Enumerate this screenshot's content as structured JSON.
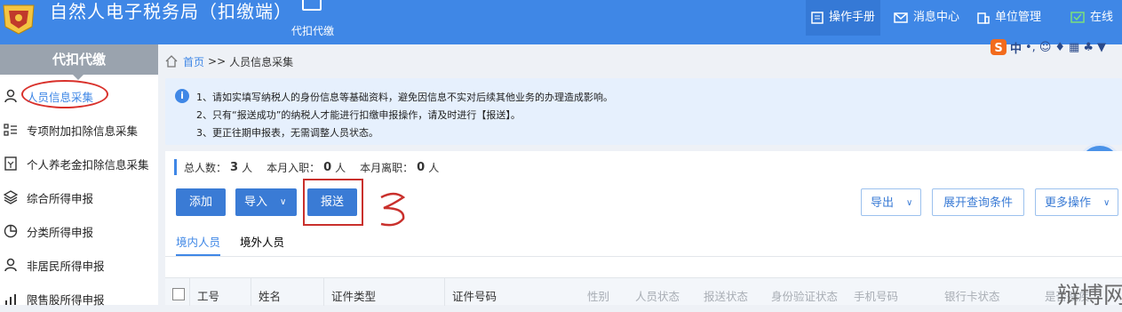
{
  "header": {
    "app_title": "自然人电子税务局（扣缴端）",
    "nav_tab": "代扣代缴",
    "tools": [
      "操作手册",
      "消息中心",
      "单位管理",
      "在线"
    ]
  },
  "ime_toolbar": {
    "lang": "中"
  },
  "sidebar": {
    "title": "代扣代缴",
    "items": [
      {
        "label": "人员信息采集",
        "icon": "person-icon"
      },
      {
        "label": "专项附加扣除信息采集",
        "icon": "list-icon"
      },
      {
        "label": "个人养老金扣除信息采集",
        "icon": "document-icon"
      },
      {
        "label": "综合所得申报",
        "icon": "layers-icon"
      },
      {
        "label": "分类所得申报",
        "icon": "pie-icon"
      },
      {
        "label": "非居民所得申报",
        "icon": "person-icon"
      },
      {
        "label": "限售股所得申报",
        "icon": "chart-icon"
      }
    ]
  },
  "breadcrumb": {
    "home": "首页",
    "sep": ">>",
    "current": "人员信息采集"
  },
  "notice": {
    "lines": [
      "1、请如实填写纳税人的身份信息等基础资料，避免因信息不实对后续其他业务的办理造成影响。",
      "2、只有“报送成功”的纳税人才能进行扣缴申报操作，请及时进行【报送】。",
      "3、更正往期申报表，无需调整人员状态。"
    ]
  },
  "stats": {
    "total_label": "总人数：",
    "total": "3",
    "total_unit": "人",
    "join_label": "本月入职：",
    "join": "0",
    "join_unit": "人",
    "leave_label": "本月离职：",
    "leave": "0",
    "leave_unit": "人"
  },
  "toolbar": {
    "add": "添加",
    "import": "导入",
    "submit": "报送",
    "export": "导出",
    "expand_query": "展开查询条件",
    "more": "更多操作"
  },
  "annotation": {
    "number": "3"
  },
  "tabs": [
    "境内人员",
    "境外人员"
  ],
  "table": {
    "headers": [
      "工号",
      "姓名",
      "证件类型",
      "证件号码",
      "性别",
      "人员状态",
      "报送状态",
      "身份验证状态",
      "手机号码",
      "银行卡状态",
      "是否残疾"
    ]
  },
  "watermark": "辩博网",
  "colors": {
    "brand": "#3f87e6",
    "button": "#3a7bd5",
    "annotation": "#c9302c"
  }
}
